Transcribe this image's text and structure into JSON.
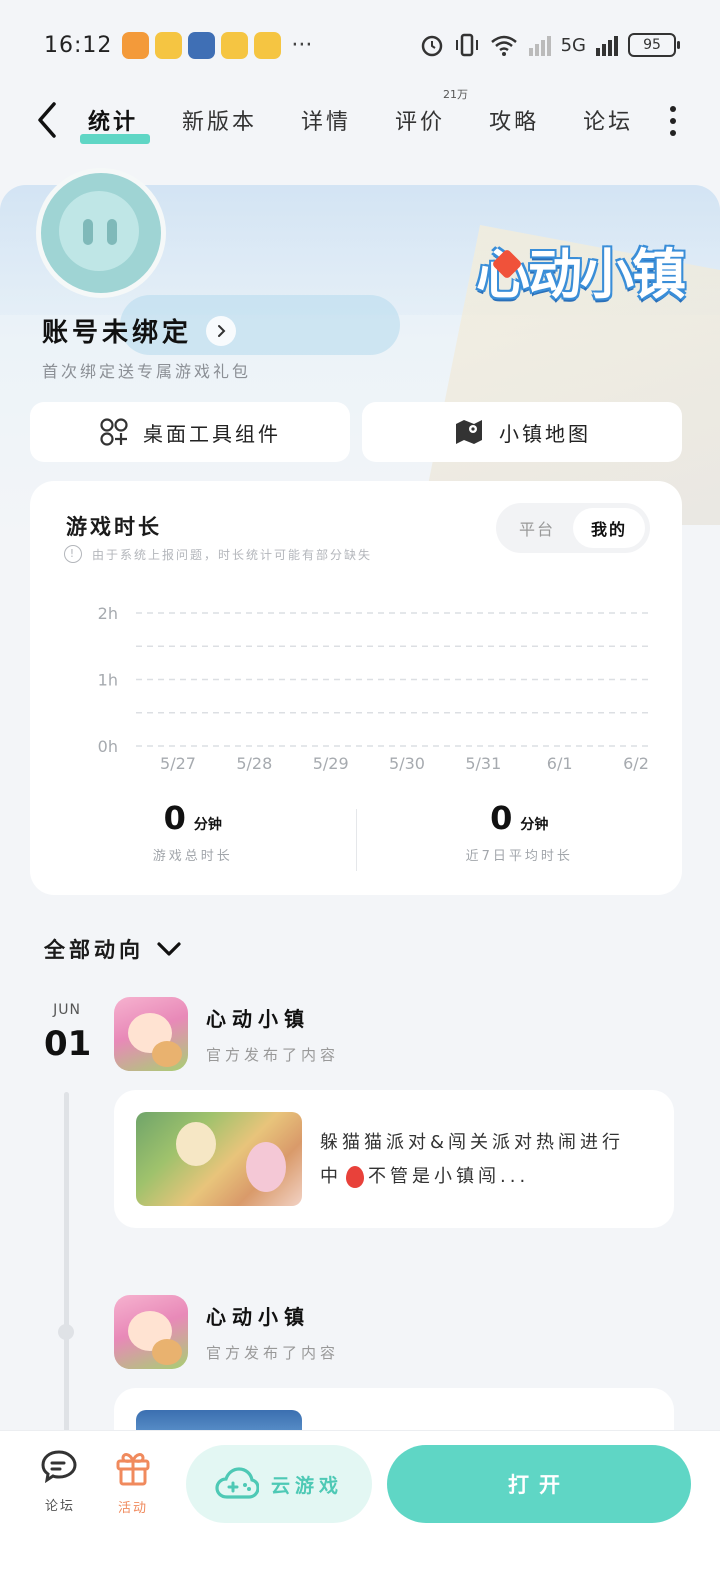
{
  "status_bar": {
    "time": "16:12",
    "more": "···",
    "network_5g": "5G",
    "battery": "95",
    "notification_colors": [
      "#f39a3a",
      "#f5c542",
      "#3f6fb5",
      "#f5c542",
      "#f5c542"
    ]
  },
  "nav": {
    "tabs": [
      {
        "label": "统计",
        "active": true
      },
      {
        "label": "新版本"
      },
      {
        "label": "详情"
      },
      {
        "label": "评价",
        "badge": "21万"
      },
      {
        "label": "攻略"
      },
      {
        "label": "论坛"
      }
    ]
  },
  "hero": {
    "game_logo": "心动小镇",
    "account_title": "账号未绑定",
    "account_subtitle": "首次绑定送专属游戏礼包"
  },
  "shortcuts": {
    "widget_label": "桌面工具组件",
    "map_label": "小镇地图"
  },
  "stats": {
    "title": "游戏时长",
    "note": "由于系统上报问题，时长统计可能有部分缺失",
    "toggle": {
      "platform": "平台",
      "mine": "我的",
      "selected": "mine"
    },
    "total_value": "0",
    "total_unit": "分钟",
    "total_label": "游戏总时长",
    "avg_value": "0",
    "avg_unit": "分钟",
    "avg_label": "近7日平均时长"
  },
  "chart_data": {
    "type": "line",
    "categories": [
      "5/27",
      "5/28",
      "5/29",
      "5/30",
      "5/31",
      "6/1",
      "6/2"
    ],
    "values": [
      0,
      0,
      0,
      0,
      0,
      0,
      0
    ],
    "yticks": [
      "0h",
      "1h",
      "2h"
    ],
    "ylim": [
      0,
      2
    ],
    "grid": true
  },
  "feed": {
    "filter_label": "全部动向",
    "date_month": "JUN",
    "date_day": "01",
    "posts": [
      {
        "author": "心动小镇",
        "action": "官方发布了内容",
        "text": "躲猫猫派对&闯关派对热闹进行中",
        "text_tail": "不管是小镇闯..."
      },
      {
        "author": "心动小镇",
        "action": "官方发布了内容"
      }
    ]
  },
  "bottom_bar": {
    "forum_label": "论坛",
    "activity_label": "活动",
    "cloud_label": "云游戏",
    "open_label": "打开",
    "accent": "#5fd6c5",
    "activity_color": "#f08a5d"
  }
}
